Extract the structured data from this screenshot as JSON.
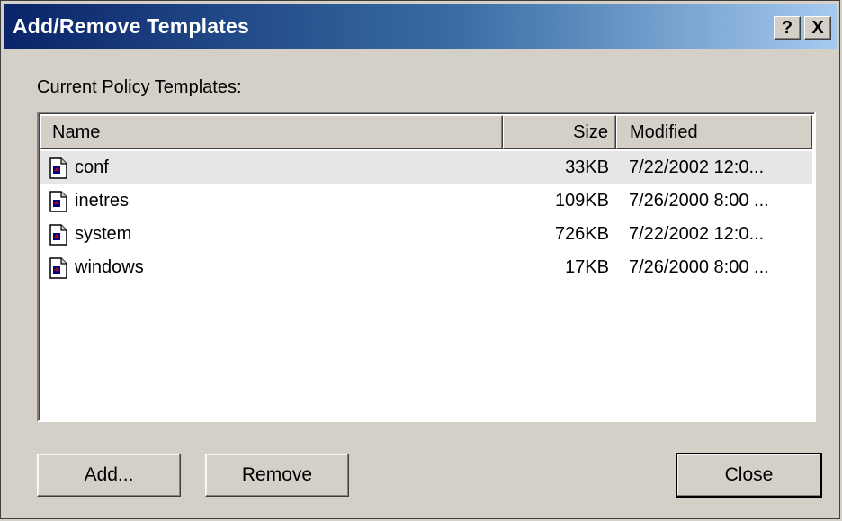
{
  "window": {
    "title": "Add/Remove Templates",
    "help_label": "?",
    "close_label": "X"
  },
  "list_label": "Current Policy Templates:",
  "columns": {
    "name": "Name",
    "size": "Size",
    "modified": "Modified"
  },
  "templates": [
    {
      "name": "conf",
      "size": "33KB",
      "modified": "7/22/2002 12:0...",
      "selected": true
    },
    {
      "name": "inetres",
      "size": "109KB",
      "modified": "7/26/2000 8:00 ..."
    },
    {
      "name": "system",
      "size": "726KB",
      "modified": "7/22/2002 12:0..."
    },
    {
      "name": "windows",
      "size": "17KB",
      "modified": "7/26/2000 8:00 ..."
    }
  ],
  "buttons": {
    "add": "Add...",
    "remove": "Remove",
    "close": "Close"
  },
  "icons": {
    "file": "template-file-icon"
  }
}
